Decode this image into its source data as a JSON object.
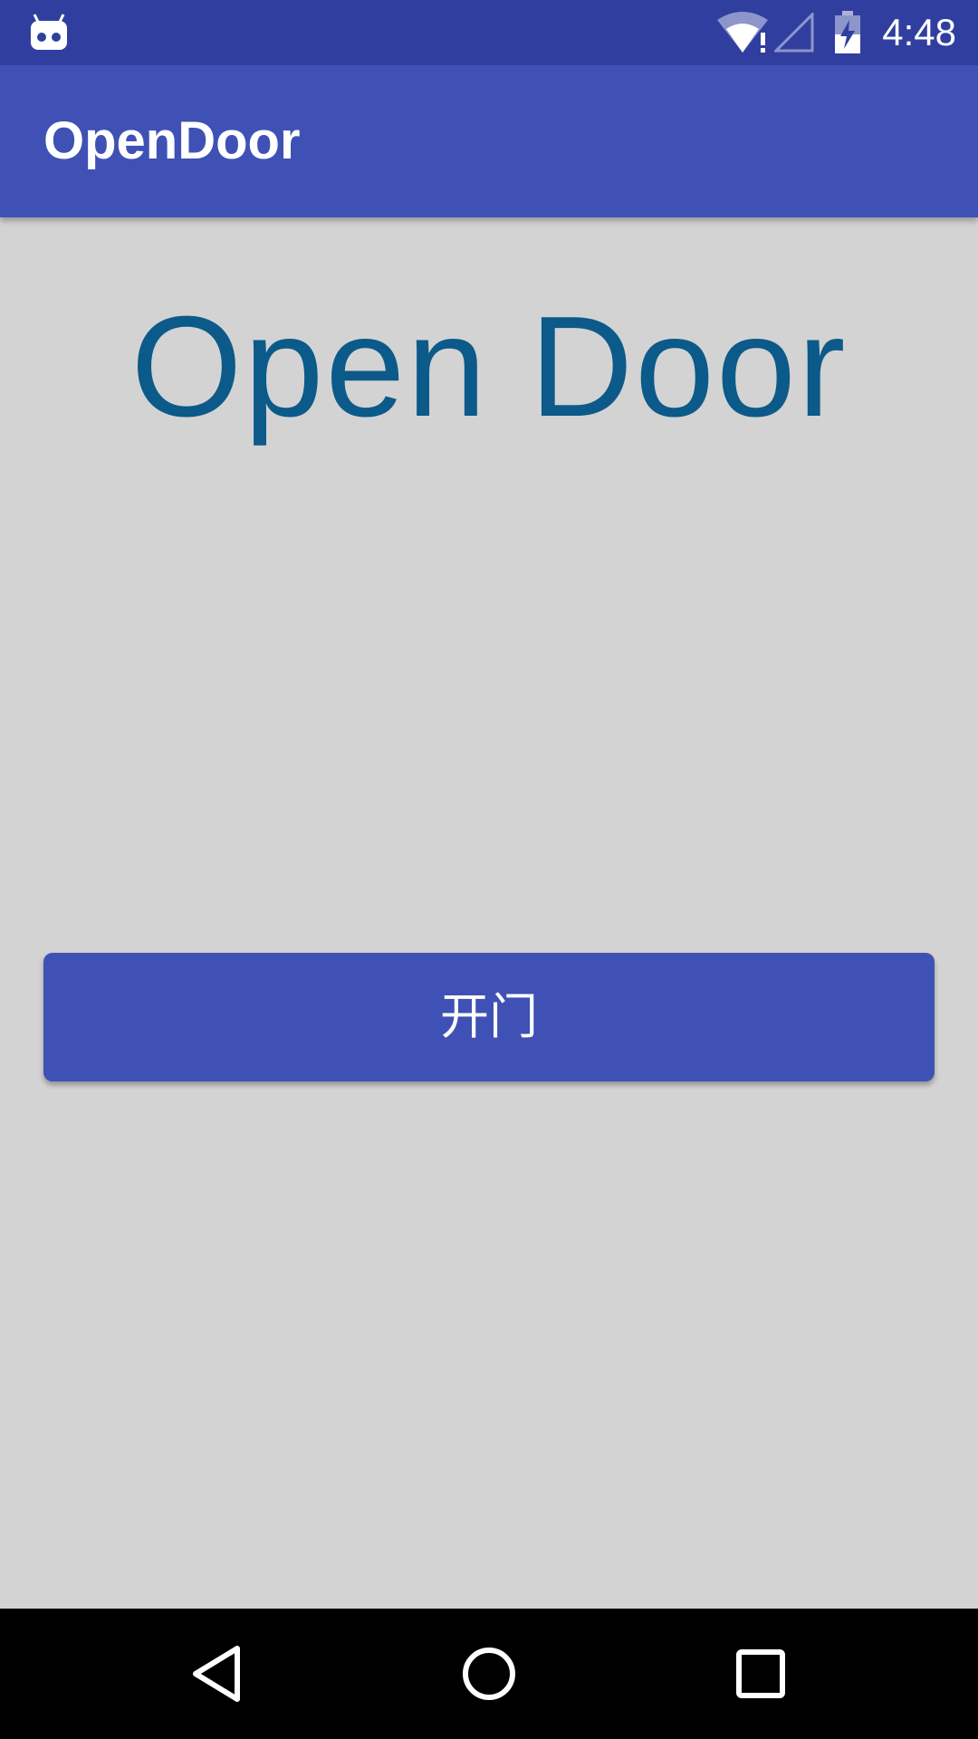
{
  "status_bar": {
    "time": "4:48",
    "icons": [
      "android-debug-icon",
      "wifi-alert-icon",
      "cell-signal-icon",
      "battery-charging-icon"
    ]
  },
  "app_bar": {
    "title": "OpenDoor"
  },
  "main": {
    "heading": "Open Door",
    "open_button_label": "开门"
  },
  "nav_bar": {
    "icons": [
      "back-icon",
      "home-icon",
      "recents-icon"
    ]
  },
  "colors": {
    "status_bar": "#303f9f",
    "primary": "#3f51b5",
    "background": "#d3d3d3",
    "heading_text": "#0b5a8a",
    "nav_bar": "#000000"
  }
}
